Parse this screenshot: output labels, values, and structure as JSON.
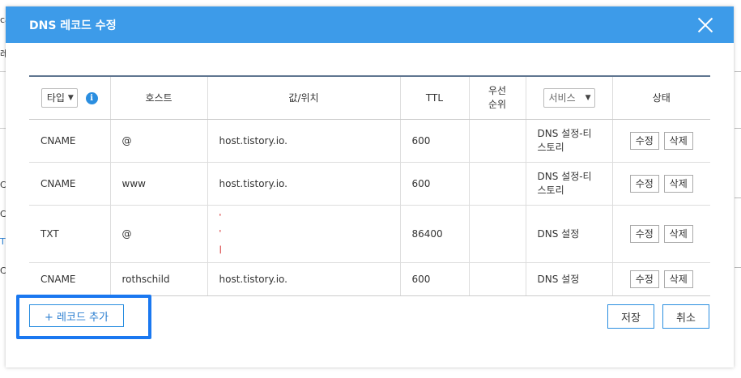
{
  "modal": {
    "title": "DNS 레코드 수정",
    "close_icon": "close-icon"
  },
  "table": {
    "headers": {
      "type_select": "타입",
      "host": "호스트",
      "value": "값/위치",
      "ttl": "TTL",
      "priority_line1": "우선",
      "priority_line2": "순위",
      "service_select": "서비스",
      "status": "상태"
    },
    "rows": [
      {
        "type": "CNAME",
        "host": "@",
        "value": "host.tistory.io.",
        "ttl": "600",
        "priority": "",
        "service_line1": "DNS 설정-티",
        "service_line2": "스토리",
        "edit": "수정",
        "delete": "삭제"
      },
      {
        "type": "CNAME",
        "host": "www",
        "value": "host.tistory.io.",
        "ttl": "600",
        "priority": "",
        "service_line1": "DNS 설정-티",
        "service_line2": "스토리",
        "edit": "수정",
        "delete": "삭제"
      },
      {
        "type": "TXT",
        "host": "@",
        "value_marks": [
          "'",
          "'",
          "|"
        ],
        "ttl": "86400",
        "priority": "",
        "service_line1": "DNS 설정",
        "service_line2": "",
        "edit": "수정",
        "delete": "삭제"
      },
      {
        "type": "CNAME",
        "host": "rothschild",
        "value": "host.tistory.io.",
        "ttl": "600",
        "priority": "",
        "service_line1": "DNS 설정",
        "service_line2": "",
        "edit": "수정",
        "delete": "삭제"
      }
    ]
  },
  "footer": {
    "add_record": "+ 레코드 추가",
    "save": "저장",
    "cancel": "취소"
  },
  "background": {
    "fragments": [
      "ca",
      "레",
      "C",
      "C",
      "T",
      "C"
    ]
  },
  "colors": {
    "header_bg": "#3d9be9",
    "accent": "#2a8ee0",
    "highlight": "#1a78f0"
  }
}
